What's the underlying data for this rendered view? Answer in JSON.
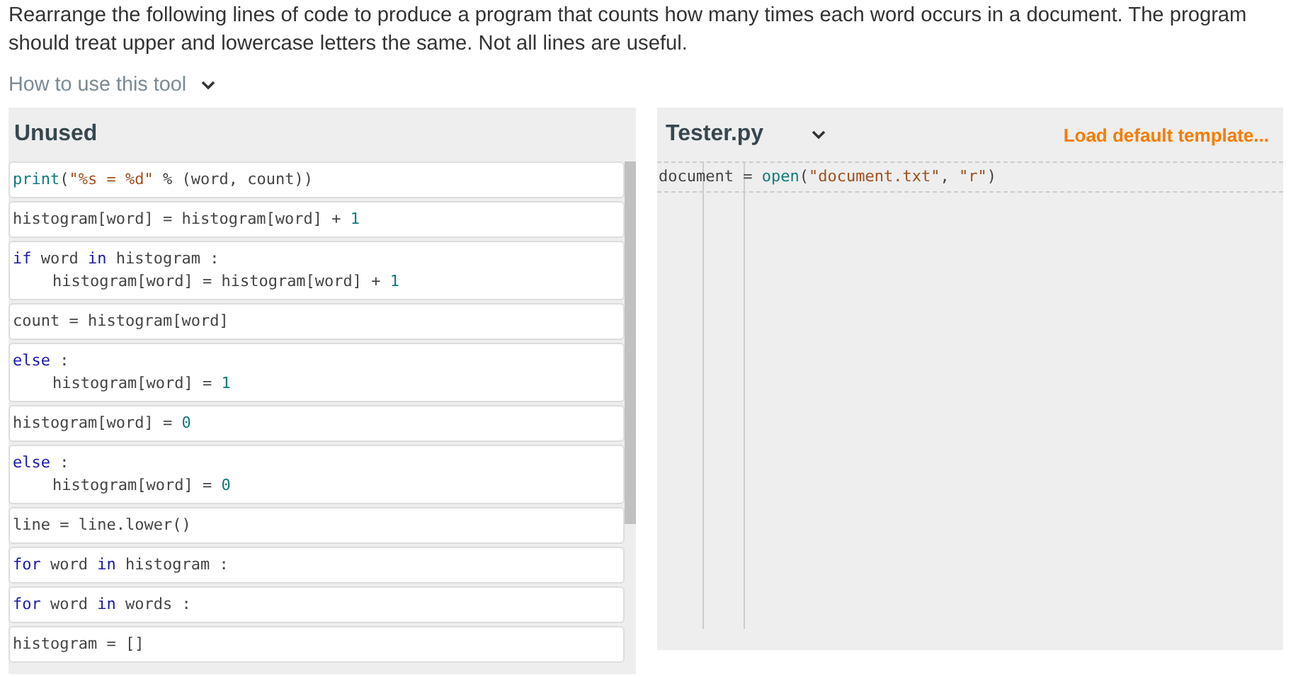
{
  "instructions": "Rearrange the following lines of code to produce a program that counts how many times each word occurs in a document. The program should treat upper and lowercase letters the same. Not all lines are useful.",
  "help_toggle": {
    "label": "How to use this tool",
    "expanded": false
  },
  "unused": {
    "title": "Unused",
    "blocks": [
      {
        "tokens": [
          {
            "kind": "builtin",
            "text": "print"
          },
          {
            "kind": "plain",
            "text": "("
          },
          {
            "kind": "string",
            "text": "\"%s = %d\""
          },
          {
            "kind": "plain",
            "text": " % (word, count))"
          }
        ]
      },
      {
        "tokens": [
          {
            "kind": "plain",
            "text": "histogram[word] = histogram[word] + "
          },
          {
            "kind": "number",
            "text": "1"
          }
        ]
      },
      {
        "tokens": [
          {
            "kind": "keyword",
            "text": "if"
          },
          {
            "kind": "plain",
            "text": " word "
          },
          {
            "kind": "keyword",
            "text": "in"
          },
          {
            "kind": "plain",
            "text": " histogram :"
          }
        ],
        "children": [
          {
            "tokens": [
              {
                "kind": "plain",
                "text": "histogram[word] = histogram[word] + "
              },
              {
                "kind": "number",
                "text": "1"
              }
            ]
          }
        ]
      },
      {
        "tokens": [
          {
            "kind": "plain",
            "text": "count = histogram[word]"
          }
        ]
      },
      {
        "tokens": [
          {
            "kind": "keyword",
            "text": "else"
          },
          {
            "kind": "plain",
            "text": " :"
          }
        ],
        "children": [
          {
            "tokens": [
              {
                "kind": "plain",
                "text": "histogram[word] = "
              },
              {
                "kind": "number",
                "text": "1"
              }
            ]
          }
        ]
      },
      {
        "tokens": [
          {
            "kind": "plain",
            "text": "histogram[word] = "
          },
          {
            "kind": "number",
            "text": "0"
          }
        ]
      },
      {
        "tokens": [
          {
            "kind": "keyword",
            "text": "else"
          },
          {
            "kind": "plain",
            "text": " :"
          }
        ],
        "children": [
          {
            "tokens": [
              {
                "kind": "plain",
                "text": "histogram[word] = "
              },
              {
                "kind": "number",
                "text": "0"
              }
            ]
          }
        ]
      },
      {
        "tokens": [
          {
            "kind": "plain",
            "text": "line = line.lower()"
          }
        ]
      },
      {
        "tokens": [
          {
            "kind": "keyword",
            "text": "for"
          },
          {
            "kind": "plain",
            "text": " word "
          },
          {
            "kind": "keyword",
            "text": "in"
          },
          {
            "kind": "plain",
            "text": " histogram :"
          }
        ]
      },
      {
        "tokens": [
          {
            "kind": "keyword",
            "text": "for"
          },
          {
            "kind": "plain",
            "text": " word "
          },
          {
            "kind": "keyword",
            "text": "in"
          },
          {
            "kind": "plain",
            "text": " words :"
          }
        ]
      },
      {
        "tokens": [
          {
            "kind": "plain",
            "text": "histogram = []"
          }
        ]
      }
    ]
  },
  "editor": {
    "file": "Tester.py",
    "load_link": "Load default template...",
    "lines": [
      {
        "tokens": [
          {
            "kind": "plain",
            "text": "document = "
          },
          {
            "kind": "builtin",
            "text": "open"
          },
          {
            "kind": "plain",
            "text": "("
          },
          {
            "kind": "string",
            "text": "\"document.txt\""
          },
          {
            "kind": "plain",
            "text": ", "
          },
          {
            "kind": "string",
            "text": "\"r\""
          },
          {
            "kind": "plain",
            "text": ")"
          }
        ]
      }
    ]
  }
}
